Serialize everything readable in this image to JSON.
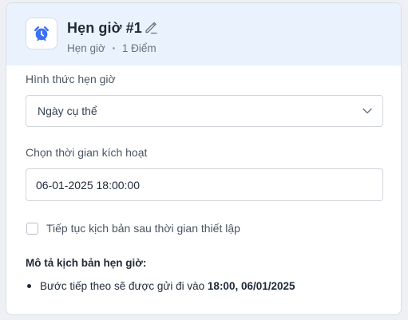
{
  "header": {
    "title": "Hẹn giờ #1",
    "subtitle_type": "Hẹn giờ",
    "subtitle_points": "1 Điểm",
    "icon": "alarm-clock-icon",
    "accent_color": "#3b6ff5",
    "header_bg": "#eaf2fd"
  },
  "schedule_type": {
    "label": "Hình thức hẹn giờ",
    "selected": "Ngày cụ thể"
  },
  "activation_time": {
    "label": "Chọn thời gian kích hoạt",
    "value": "06-01-2025 18:00:00"
  },
  "continue_option": {
    "label": "Tiếp tục kịch bản sau thời gian thiết lập",
    "checked": false
  },
  "description": {
    "title": "Mô tả kịch bản hẹn giờ:",
    "text_prefix": "Bước tiếp theo sẽ được gửi đi vào ",
    "highlight": "18:00, 06/01/2025"
  }
}
